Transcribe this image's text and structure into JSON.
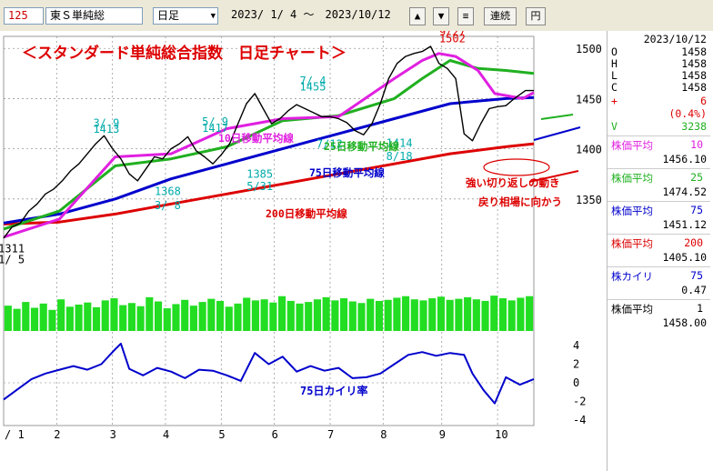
{
  "toolbar": {
    "code": "125",
    "name": "東Ｓ単純総",
    "period": "日足",
    "range": "2023/ 1/ 4 ～　2023/10/12",
    "up": "▲",
    "down": "▼",
    "menu": "≡",
    "link": "連続",
    "yen": "円"
  },
  "panel": {
    "date": "2023/10/12",
    "ohlc": [
      {
        "k": "O",
        "v": "1458"
      },
      {
        "k": "H",
        "v": "1458"
      },
      {
        "k": "L",
        "v": "1458"
      },
      {
        "k": "C",
        "v": "1458"
      }
    ],
    "change": {
      "k": "+",
      "v": "6"
    },
    "change_pct": "(0.4%)",
    "volume": {
      "k": "V",
      "v": "3238"
    },
    "mas": [
      {
        "label": "株価平均",
        "period": "10",
        "value": "1456.10",
        "color": "#e020e0"
      },
      {
        "label": "株価平均",
        "period": "25",
        "value": "1474.52",
        "color": "#20b020"
      },
      {
        "label": "株価平均",
        "period": "75",
        "value": "1451.12",
        "color": "#0000cc"
      },
      {
        "label": "株価平均",
        "period": "200",
        "value": "1405.10",
        "color": "#dd0000"
      },
      {
        "label": "株カイリ",
        "period": "75",
        "value": "0.47",
        "color": "#0000cc"
      },
      {
        "label": "株価平均",
        "period": "1",
        "value": "1458.00",
        "color": "#000000"
      }
    ]
  },
  "chart_data": {
    "type": "line",
    "title": "＜スタンダード単純総合指数　日足チャート＞",
    "x_months": [
      "1",
      "2",
      "3",
      "4",
      "5",
      "6",
      "7",
      "8",
      "9",
      "10"
    ],
    "y_ticks": [
      1350,
      1400,
      1450,
      1500
    ],
    "ylim": [
      1300,
      1512
    ],
    "series_price": {
      "name": "",
      "x": [
        0,
        3,
        6,
        9,
        12,
        15,
        18,
        21,
        24,
        27,
        30,
        33,
        36,
        39,
        42,
        45,
        48,
        51,
        54,
        57,
        60,
        63,
        66,
        69,
        72,
        75,
        78,
        81,
        84,
        87,
        90,
        93,
        96,
        99,
        102,
        105,
        108,
        111,
        114,
        117,
        120,
        123,
        126,
        129,
        132,
        135,
        138,
        141,
        144,
        147,
        150,
        153,
        156,
        159,
        162,
        165,
        168,
        171,
        174,
        177,
        180,
        183,
        186,
        187,
        190
      ],
      "y": [
        1311,
        1322,
        1326,
        1338,
        1345,
        1355,
        1360,
        1368,
        1378,
        1385,
        1395,
        1405,
        1413,
        1400,
        1390,
        1375,
        1368,
        1380,
        1392,
        1390,
        1400,
        1405,
        1412,
        1398,
        1392,
        1385,
        1394,
        1405,
        1425,
        1445,
        1455,
        1440,
        1425,
        1430,
        1438,
        1444,
        1440,
        1436,
        1432,
        1432,
        1430,
        1426,
        1418,
        1414,
        1425,
        1445,
        1470,
        1485,
        1492,
        1495,
        1497,
        1502,
        1485,
        1480,
        1470,
        1415,
        1408,
        1425,
        1440,
        1442,
        1443,
        1450,
        1456,
        1458,
        1458
      ]
    },
    "series": [
      {
        "name": "10日移動平均線",
        "color": "#e020e0",
        "x": [
          0,
          20,
          40,
          60,
          80,
          100,
          120,
          140,
          150,
          156,
          162,
          170,
          176,
          186,
          190
        ],
        "y": [
          1312,
          1330,
          1392,
          1395,
          1420,
          1430,
          1432,
          1470,
          1488,
          1495,
          1492,
          1478,
          1455,
          1450,
          1456
        ]
      },
      {
        "name": "25日移動平均線",
        "color": "#20b020",
        "x": [
          0,
          20,
          40,
          60,
          80,
          100,
          120,
          140,
          150,
          160,
          170,
          180,
          190
        ],
        "y": [
          1320,
          1338,
          1383,
          1390,
          1402,
          1428,
          1433,
          1450,
          1470,
          1488,
          1480,
          1478,
          1475
        ]
      },
      {
        "name": "75日移動平均線",
        "color": "#0000cc",
        "x": [
          0,
          20,
          40,
          60,
          80,
          100,
          120,
          140,
          160,
          180,
          190
        ],
        "y": [
          1326,
          1335,
          1350,
          1370,
          1385,
          1400,
          1415,
          1430,
          1445,
          1450,
          1451
        ]
      },
      {
        "name": "200日移動平均線",
        "color": "#dd0000",
        "x": [
          0,
          20,
          40,
          60,
          80,
          100,
          120,
          140,
          160,
          180,
          190
        ],
        "y": [
          1325,
          1327,
          1335,
          1345,
          1355,
          1365,
          1375,
          1385,
          1395,
          1402,
          1405
        ]
      }
    ],
    "volume": {
      "y_range": [
        0,
        100
      ],
      "values": [
        48,
        42,
        55,
        44,
        52,
        40,
        60,
        46,
        50,
        54,
        45,
        58,
        62,
        49,
        53,
        47,
        64,
        56,
        43,
        51,
        59,
        48,
        55,
        61,
        57,
        46,
        52,
        63,
        58,
        60,
        54,
        66,
        57,
        52,
        55,
        60,
        64,
        58,
        62,
        56,
        53,
        61,
        57,
        59,
        63,
        66,
        60,
        58,
        62,
        65,
        59,
        61,
        64,
        60,
        57,
        67,
        62,
        58,
        63,
        66
      ]
    },
    "kairi": {
      "name": "75日カイリ率",
      "ylim": [
        -4,
        4
      ],
      "ticks": [
        4,
        2,
        0,
        -2,
        -4
      ],
      "x": [
        0,
        5,
        10,
        15,
        20,
        25,
        30,
        35,
        40,
        42,
        45,
        50,
        55,
        60,
        65,
        70,
        75,
        80,
        85,
        90,
        95,
        100,
        105,
        110,
        115,
        120,
        125,
        130,
        135,
        140,
        145,
        150,
        155,
        160,
        165,
        168,
        172,
        176,
        180,
        185,
        190
      ],
      "y": [
        -1.8,
        -0.7,
        0.4,
        1.0,
        1.4,
        1.8,
        1.4,
        2.0,
        3.6,
        4.2,
        1.5,
        0.8,
        1.6,
        1.2,
        0.5,
        1.4,
        1.3,
        0.8,
        0.2,
        3.2,
        2.0,
        2.8,
        1.2,
        1.8,
        1.3,
        1.6,
        0.5,
        0.6,
        1.0,
        2.0,
        3.0,
        3.3,
        2.9,
        3.2,
        3.0,
        1.0,
        -0.8,
        -2.2,
        0.6,
        -0.2,
        0.4
      ]
    },
    "annotations": [
      {
        "text": "3/ 9",
        "x": 36,
        "y": 1422,
        "color": "#00aaaa"
      },
      {
        "text": "1413",
        "x": 36,
        "y": 1416,
        "color": "#00aaaa"
      },
      {
        "text": "5/ 9",
        "x": 75,
        "y": 1423,
        "color": "#00aaaa"
      },
      {
        "text": "1417",
        "x": 75,
        "y": 1417,
        "color": "#00aaaa"
      },
      {
        "text": "7/ 4",
        "x": 110,
        "y": 1464,
        "color": "#00aaaa"
      },
      {
        "text": "1455",
        "x": 110,
        "y": 1458,
        "color": "#00aaaa"
      },
      {
        "text": "9/27",
        "x": 160,
        "y": 1513,
        "color": "#dd0000"
      },
      {
        "text": "1502",
        "x": 160,
        "y": 1506,
        "color": "#dd0000"
      },
      {
        "text": "1368",
        "x": 58,
        "y": 1354,
        "color": "#00aaaa"
      },
      {
        "text": "3/ 8",
        "x": 58,
        "y": 1340,
        "color": "#00aaaa"
      },
      {
        "text": "1385",
        "x": 91,
        "y": 1371,
        "color": "#00aaaa"
      },
      {
        "text": "5/31",
        "x": 91,
        "y": 1359,
        "color": "#00aaaa"
      },
      {
        "text": "7/12",
        "x": 116,
        "y": 1401,
        "color": "#00aaaa"
      },
      {
        "text": "1414",
        "x": 141,
        "y": 1402,
        "color": "#00aaaa"
      },
      {
        "text": "8/18",
        "x": 141,
        "y": 1389,
        "color": "#00aaaa"
      },
      {
        "text": "1311",
        "x": 2,
        "y": 1297,
        "color": "#000000"
      },
      {
        "text": "1/ 5",
        "x": 2,
        "y": 1286,
        "color": "#000000"
      }
    ],
    "labels": [
      {
        "text": "10日移動平均線",
        "color": "#e020e0"
      },
      {
        "text": "25日移動平均線",
        "color": "#20b020"
      },
      {
        "text": "75日移動平均線",
        "color": "#0000cc"
      },
      {
        "text": "200日移動平均線",
        "color": "#dd0000"
      },
      {
        "text": "強い切り返しの動き",
        "color": "#dd0000"
      },
      {
        "text": "戻り相場に向かう",
        "color": "#dd0000"
      }
    ]
  }
}
